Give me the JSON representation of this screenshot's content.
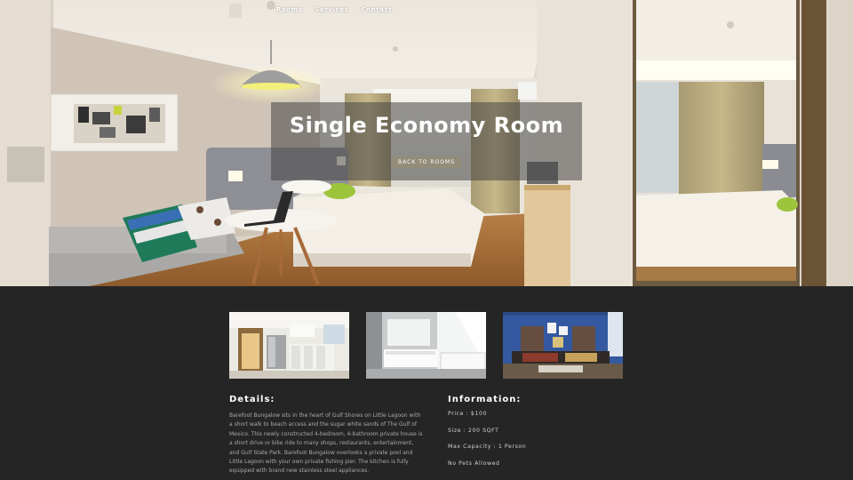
{
  "nav": {
    "items": [
      "Rooms",
      "Services",
      "Contact"
    ]
  },
  "hero": {
    "title": "Single Economy Room",
    "back_button": "BACK TO ROOMS"
  },
  "gallery": {
    "thumbnails": [
      "kitchen-photo",
      "bathroom-photo",
      "living-room-photo"
    ]
  },
  "details": {
    "heading": "Details:",
    "text": "Barefoot Bungalow sits in the heart of Gulf Shores on Little Lagoon with a short walk to beach access and the sugar white sands of The Gulf of Mexico. This newly constructed 4-bedroom, 4-bathroom private house is a short drive or bike ride to many shops, restaurants, entertainment, and Gulf State Park. Barefoot Bungalow overlooks a private pool and Little Lagoon with your own private fishing pier. The kitchen is fully equipped with brand new stainless steel appliances."
  },
  "information": {
    "heading": "Information:",
    "items": [
      "Price : $100",
      "Size : 200 SQFT",
      "Max Capacity : 1 Person",
      "No Pets Allowed"
    ]
  },
  "colors": {
    "background": "#252525",
    "text": "#ffffff",
    "muted_text": "#a9a9a9",
    "button": "#968c73"
  }
}
